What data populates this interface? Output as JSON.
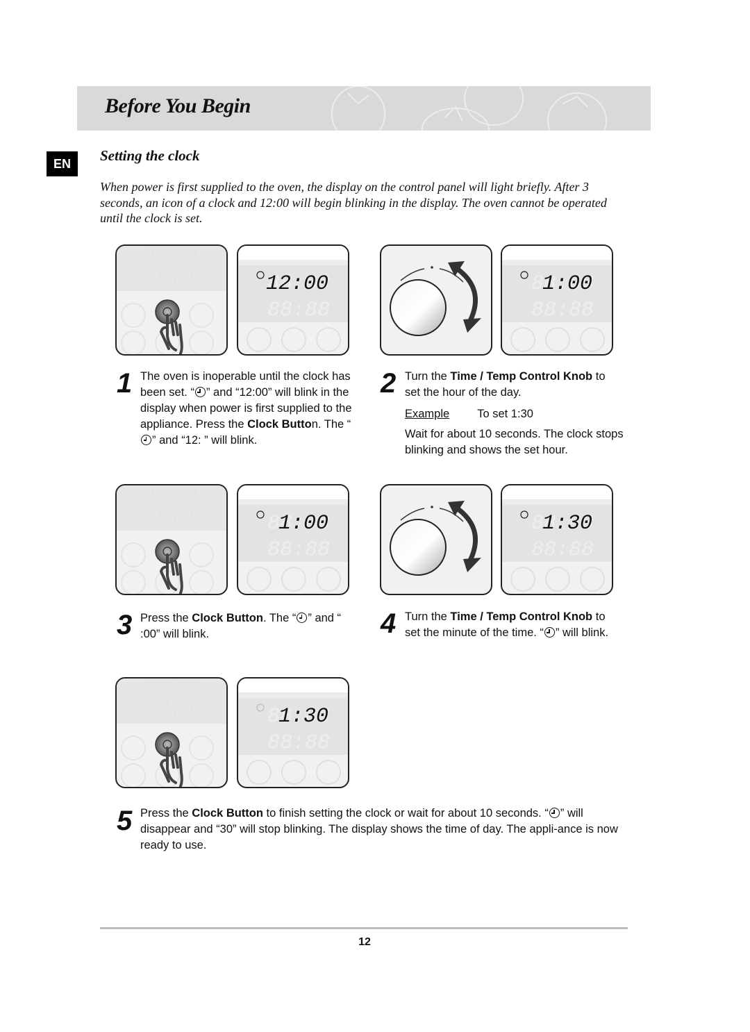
{
  "header": {
    "title": "Before You Begin",
    "background": "#d9d9d9"
  },
  "language_badge": "EN",
  "section": {
    "title": "Setting the clock",
    "intro": "When power is first supplied to the oven, the display on the control panel will light briefly. After 3 seconds, an icon of a clock and 12:00 will begin blinking in the display. The oven cannot be operated until the clock is set."
  },
  "panels": {
    "p1_display": "12:00",
    "p2_display": "1:00",
    "p3_display": "1:00",
    "p4_display": "1:30",
    "p5_display": "1:30",
    "idle_display": "88:88"
  },
  "steps": [
    {
      "number": "1",
      "t1": "The oven is inoperable until the clock has been set. “",
      "t2": "” and “12:00” will blink in the display when power is first supplied to the appliance. Press the ",
      "bold": "Clock Butto",
      "t3": "n. The “",
      "t4": "” and “12: ” will blink."
    },
    {
      "number": "2",
      "t1": "Turn the ",
      "bold": "Time / Temp Control Knob",
      "t2": " to set the hour of the day.",
      "example_label": "Example",
      "example_value": "To set 1:30",
      "note": "Wait for about 10 seconds. The clock stops blinking and shows the set hour."
    },
    {
      "number": "3",
      "t1": "Press the ",
      "bold": "Clock Button",
      "t2": ". The “",
      "t3": "” and “ :00” will blink."
    },
    {
      "number": "4",
      "t1": "Turn the ",
      "bold": "Time / Temp Control Knob",
      "t2": " to set the minute of the time. “",
      "t3": "” will blink."
    },
    {
      "number": "5",
      "t1": "Press the ",
      "bold": "Clock Button",
      "t2": " to finish setting the clock or wait for about 10 seconds. “",
      "t3": "” will disappear and “30” will stop blinking. The display shows the time of day. The appli-ance is now ready to use."
    }
  ],
  "footer": {
    "page_number": "12"
  }
}
